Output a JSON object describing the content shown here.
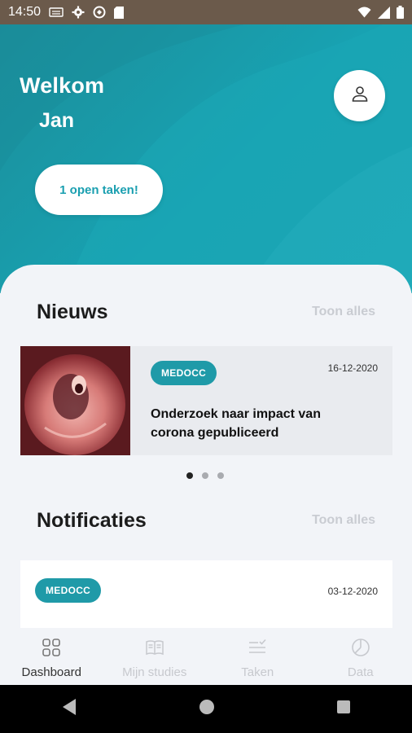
{
  "status_bar": {
    "time": "14:50",
    "icons": [
      "keyboard-icon",
      "gear-icon",
      "sync-icon",
      "sd-card-icon",
      "wifi-icon",
      "signal-icon",
      "battery-icon"
    ]
  },
  "header": {
    "welcome": "Welkom",
    "username": "Jan",
    "open_tasks_label": "1 open taken!"
  },
  "news": {
    "title": "Nieuws",
    "show_all": "Toon alles",
    "items": [
      {
        "badge": "MEDOCC",
        "date": "16-12-2020",
        "title": "Onderzoek naar impact van corona gepubliceerd"
      }
    ],
    "carousel_count": 3,
    "carousel_active": 0
  },
  "notifications": {
    "title": "Notificaties",
    "show_all": "Toon alles",
    "items": [
      {
        "badge": "MEDOCC",
        "date": "03-12-2020"
      }
    ]
  },
  "nav": {
    "items": [
      {
        "label": "Dashboard",
        "icon": "grid-icon",
        "active": true
      },
      {
        "label": "Mijn studies",
        "icon": "book-icon",
        "active": false
      },
      {
        "label": "Taken",
        "icon": "checklist-icon",
        "active": false
      },
      {
        "label": "Data",
        "icon": "pie-chart-icon",
        "active": false
      }
    ]
  },
  "colors": {
    "accent": "#1a9fb0",
    "badge": "#1f9aa8",
    "status_bar": "#6b5a4b"
  }
}
